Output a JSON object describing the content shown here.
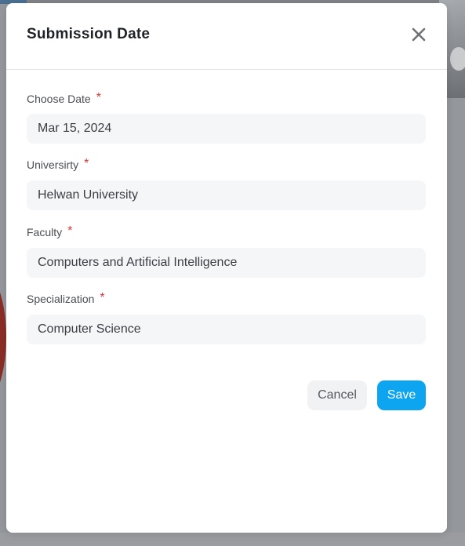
{
  "dialog": {
    "title": "Submission Date"
  },
  "fields": [
    {
      "label": "Choose Date",
      "required_mark": "*",
      "value": "Mar 15, 2024"
    },
    {
      "label": "Universirty",
      "required_mark": "*",
      "value": "Helwan University"
    },
    {
      "label": "Faculty",
      "required_mark": "*",
      "value": "Computers and Artificial Intelligence"
    },
    {
      "label": "Specialization",
      "required_mark": "*",
      "value": "Computer Science"
    }
  ],
  "actions": {
    "cancel_label": "Cancel",
    "save_label": "Save"
  },
  "colors": {
    "primary": "#0ea5f0",
    "required": "#d9343a",
    "field_background": "#f5f6f8",
    "overlay": "#94979b"
  },
  "icons": {
    "close": "close-icon"
  }
}
